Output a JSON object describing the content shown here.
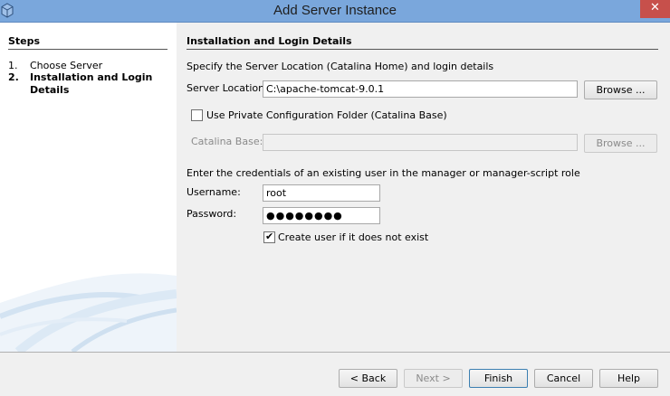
{
  "window": {
    "title": "Add Server Instance",
    "close_glyph": "✕",
    "app_icon": "netbeans-cube-icon"
  },
  "steps": {
    "title": "Steps",
    "items": [
      {
        "num": "1.",
        "label": "Choose Server",
        "active": false
      },
      {
        "num": "2.",
        "label": "Installation and Login Details",
        "active": true
      }
    ]
  },
  "main": {
    "section_title": "Installation and Login Details",
    "instruction": "Specify the Server Location (Catalina Home) and login details",
    "server_location": {
      "label": "Server Location:",
      "value": "C:\\apache-tomcat-9.0.1",
      "browse_label": "Browse ..."
    },
    "private_config": {
      "label": "Use Private Configuration Folder (Catalina Base)",
      "checked": false
    },
    "catalina_base": {
      "label": "Catalina Base:",
      "value": "",
      "browse_label": "Browse ..."
    },
    "credentials_text": "Enter the credentials of an existing user in the manager or manager-script role",
    "username": {
      "label": "Username:",
      "value": "root"
    },
    "password": {
      "label": "Password:",
      "value": "●●●●●●●●"
    },
    "create_user": {
      "label": "Create user if it does not exist",
      "checked": true,
      "check_glyph": "✔"
    }
  },
  "footer": {
    "back_label": "< Back",
    "next_label": "Next >",
    "finish_label": "Finish",
    "cancel_label": "Cancel",
    "help_label": "Help"
  }
}
